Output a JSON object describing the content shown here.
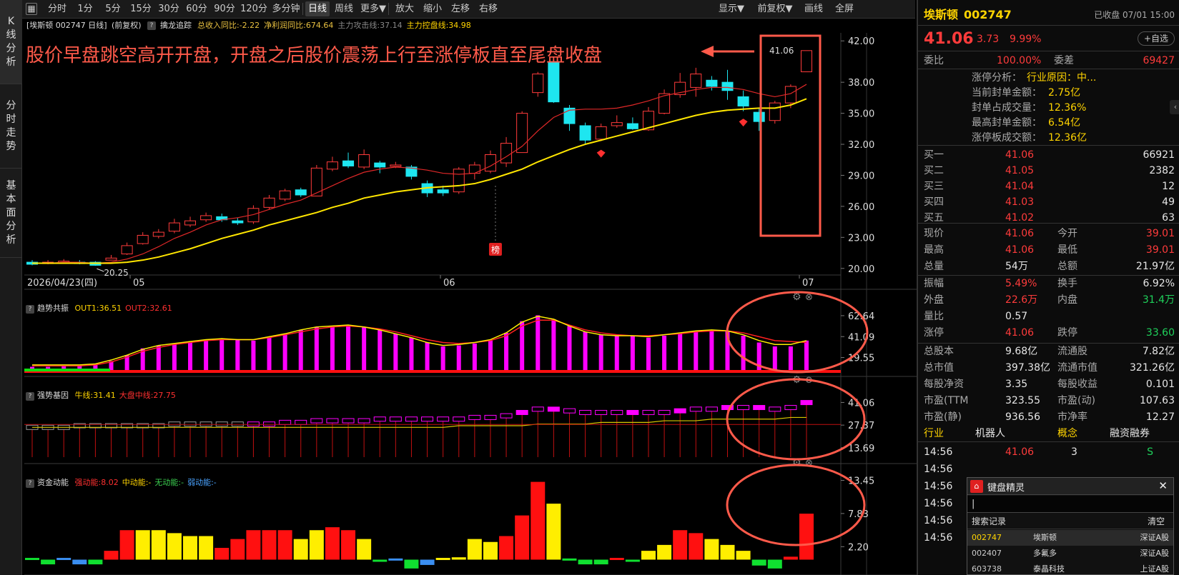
{
  "left_nav": [
    "K线分析",
    "分时走势",
    "基本面分析"
  ],
  "toolbar": {
    "left": [
      "分时",
      "1分",
      "5分",
      "15分",
      "30分",
      "60分",
      "90分",
      "120分",
      "多分钟",
      "日线",
      "周线",
      "更多▼",
      "放大",
      "缩小",
      "左移",
      "右移"
    ],
    "right": [
      "显示▼",
      "前复权▼",
      "画线",
      "全屏"
    ],
    "active": "日线"
  },
  "infobar": {
    "stock": "[埃斯顿 002747 日线]",
    "adj": "(前复权)",
    "indicator_name": "擒龙追踪",
    "fields": [
      {
        "text": "总收入同比:-2.22",
        "color": "#e8c040"
      },
      {
        "text": "净利润同比:674.64",
        "color": "#e8c040"
      },
      {
        "text": "主力攻击线:37.14",
        "color": "#888888"
      },
      {
        "text": "主力控盘线:34.98",
        "color": "#ffd400"
      }
    ]
  },
  "annotation": "股价早盘跳空高开开盘，开盘之后股价震荡上行至涨停板直至尾盘收盘",
  "main_chart": {
    "y_ticks": [
      "42.00",
      "38.00",
      "35.00",
      "32.00",
      "29.00",
      "26.00",
      "23.00",
      "20.00"
    ],
    "x_labels": [
      "2026/04/23(四)",
      "05",
      "06",
      "07"
    ],
    "low_label": "20.25",
    "high_label": "41.06",
    "badge": "榜"
  },
  "chart_data": [
    {
      "type": "candlestick",
      "title": "埃斯顿 002747 日线",
      "ylim": [
        19.5,
        42.5
      ],
      "candles": [
        [
          20.6,
          20.4,
          20.8,
          20.3
        ],
        [
          20.5,
          20.6,
          20.8,
          20.4
        ],
        [
          20.6,
          20.7,
          20.9,
          20.5
        ],
        [
          20.6,
          20.5,
          20.8,
          20.4
        ],
        [
          20.6,
          20.3,
          20.7,
          20.25
        ],
        [
          20.8,
          21.0,
          21.3,
          20.8
        ],
        [
          21.4,
          22.2,
          22.5,
          21.3
        ],
        [
          22.4,
          23.2,
          23.5,
          22.3
        ],
        [
          23.1,
          23.5,
          23.8,
          22.9
        ],
        [
          23.6,
          24.4,
          24.8,
          23.4
        ],
        [
          24.2,
          24.6,
          25.0,
          24.0
        ],
        [
          24.7,
          25.1,
          25.4,
          24.5
        ],
        [
          25.0,
          24.7,
          25.3,
          24.5
        ],
        [
          24.6,
          24.4,
          24.9,
          24.2
        ],
        [
          24.5,
          25.8,
          26.1,
          24.3
        ],
        [
          25.9,
          26.8,
          27.1,
          25.7
        ],
        [
          26.7,
          27.5,
          27.7,
          26.5
        ],
        [
          27.6,
          27.1,
          27.8,
          26.9
        ],
        [
          27.0,
          29.7,
          30.0,
          27.0
        ],
        [
          29.6,
          30.3,
          30.8,
          29.4
        ],
        [
          30.4,
          29.9,
          31.2,
          29.7
        ],
        [
          29.8,
          31.0,
          31.5,
          29.6
        ],
        [
          30.2,
          29.8,
          30.4,
          29.2
        ],
        [
          29.9,
          30.0,
          30.3,
          29.7
        ],
        [
          29.8,
          28.9,
          30.0,
          28.6
        ],
        [
          28.2,
          27.3,
          28.5,
          26.9
        ],
        [
          27.6,
          27.3,
          28.0,
          27.0
        ],
        [
          27.4,
          29.6,
          29.8,
          27.2
        ],
        [
          29.2,
          30.0,
          30.3,
          28.6
        ],
        [
          29.4,
          31.0,
          31.4,
          29.2
        ],
        [
          30.2,
          32.1,
          32.7,
          29.8
        ],
        [
          31.2,
          35.0,
          35.2,
          31.2
        ],
        [
          37.0,
          38.8,
          39.0,
          36.6
        ],
        [
          40.0,
          36.1,
          40.1,
          36.0
        ],
        [
          35.5,
          34.0,
          35.8,
          33.3
        ],
        [
          33.8,
          32.4,
          34.1,
          32.0
        ],
        [
          32.5,
          33.7,
          34.0,
          32.3
        ],
        [
          33.8,
          34.1,
          34.8,
          33.6
        ],
        [
          34.0,
          33.5,
          34.6,
          33.4
        ],
        [
          33.4,
          35.2,
          35.6,
          33.3
        ],
        [
          35.0,
          36.9,
          37.3,
          34.9
        ],
        [
          36.8,
          38.0,
          38.9,
          36.5
        ],
        [
          37.5,
          38.8,
          39.4,
          36.6
        ],
        [
          38.2,
          37.6,
          38.6,
          37.2
        ],
        [
          38.0,
          37.2,
          39.2,
          36.3
        ],
        [
          36.6,
          35.7,
          37.2,
          35.2
        ],
        [
          35.1,
          34.2,
          35.5,
          33.3
        ],
        [
          34.3,
          36.0,
          36.2,
          34.0
        ],
        [
          36.0,
          37.6,
          37.8,
          35.5
        ],
        [
          39.01,
          41.06,
          41.06,
          39.01
        ]
      ],
      "ma_red": [
        20.5,
        20.5,
        20.6,
        20.6,
        20.5,
        20.6,
        20.9,
        21.4,
        22.1,
        22.9,
        23.5,
        24.2,
        24.7,
        24.9,
        25.2,
        25.7,
        26.2,
        26.6,
        27.3,
        28.0,
        28.7,
        29.3,
        29.6,
        29.8,
        29.7,
        29.5,
        29.2,
        29.1,
        29.2,
        29.9,
        30.8,
        31.8,
        33.3,
        34.6,
        35.3,
        35.4,
        35.4,
        35.5,
        35.8,
        36.2,
        36.7,
        37.0,
        37.3,
        37.5,
        37.5,
        37.3,
        36.9,
        36.6,
        36.9,
        37.8
      ],
      "ma_yellow": [
        20.5,
        20.5,
        20.5,
        20.5,
        20.5,
        20.5,
        20.6,
        20.8,
        21.1,
        21.5,
        21.9,
        22.4,
        22.9,
        23.3,
        23.7,
        24.2,
        24.6,
        25.0,
        25.4,
        25.9,
        26.3,
        26.8,
        27.1,
        27.4,
        27.6,
        27.8,
        27.9,
        28.0,
        28.2,
        28.6,
        29.1,
        29.6,
        30.3,
        30.9,
        31.5,
        32.0,
        32.4,
        32.8,
        33.2,
        33.6,
        34.0,
        34.4,
        34.8,
        35.1,
        35.3,
        35.4,
        35.5,
        35.5,
        35.8,
        36.4
      ]
    },
    {
      "type": "bar",
      "title": "趋势共振",
      "legend": [
        {
          "name": "OUT1:36.51",
          "color": "#ffd400"
        },
        {
          "name": "OUT2:32.61",
          "color": "#ff3030"
        }
      ],
      "ylim": [
        6,
        67
      ],
      "y_ticks": [
        "62.64",
        "41.09",
        "19.55"
      ],
      "values": [
        10,
        10,
        11,
        11,
        12,
        16,
        22,
        29,
        32,
        34,
        36,
        38,
        39,
        38,
        37,
        40,
        44,
        48,
        51,
        52,
        53,
        51,
        48,
        44,
        40,
        35,
        31,
        32,
        34,
        37,
        45,
        57,
        63,
        59,
        52,
        46,
        43,
        42,
        42,
        40,
        42,
        45,
        47,
        48,
        47,
        42,
        35,
        31,
        31,
        37
      ],
      "out1": [
        12,
        12,
        12,
        12,
        13,
        17,
        22,
        28,
        32,
        34,
        36,
        38,
        39,
        38,
        38,
        41,
        44,
        48,
        51,
        52,
        53,
        51,
        48,
        44,
        40,
        35,
        32,
        33,
        35,
        38,
        45,
        56,
        62,
        59,
        52,
        46,
        43,
        42,
        42,
        41,
        43,
        45,
        47,
        48,
        47,
        43,
        37,
        33,
        33,
        37
      ],
      "out2": [
        11,
        11,
        11,
        11,
        12,
        15,
        20,
        26,
        30,
        33,
        35,
        37,
        38,
        38,
        38,
        40,
        43,
        46,
        49,
        51,
        52,
        51,
        49,
        46,
        42,
        38,
        35,
        34,
        35,
        37,
        42,
        52,
        58,
        58,
        53,
        48,
        45,
        43,
        42,
        42,
        43,
        44,
        46,
        47,
        47,
        45,
        41,
        37,
        36,
        35
      ]
    },
    {
      "type": "bar",
      "title": "强势基因",
      "legend": [
        {
          "name": "牛线:31.41",
          "color": "#ffd400"
        },
        {
          "name": "大盘中线:27.75",
          "color": "#ff3030"
        }
      ],
      "ylim": [
        8,
        46
      ],
      "y_ticks": [
        "41.06",
        "27.37",
        "13.69"
      ],
      "values": [
        26,
        26,
        26,
        27,
        27,
        27,
        27,
        27,
        27,
        28,
        28,
        28,
        28,
        28,
        28,
        28,
        29,
        29,
        30,
        30,
        30,
        30,
        31,
        31,
        31,
        31,
        31,
        31,
        32,
        32,
        33,
        35,
        37,
        37,
        36,
        35,
        35,
        35,
        35,
        35,
        35,
        36,
        37,
        37,
        38,
        38,
        38,
        37,
        38,
        41
      ],
      "niu": [
        26,
        26,
        26,
        26,
        26,
        26,
        26,
        26,
        26,
        26,
        26,
        26,
        26,
        26,
        26,
        26,
        26,
        26,
        26,
        26,
        26,
        26,
        26,
        26,
        26,
        26,
        26,
        27,
        27,
        27,
        27,
        27,
        28,
        28,
        28,
        28,
        29,
        29,
        29,
        29,
        30,
        30,
        30,
        31,
        31,
        31,
        31,
        31,
        32,
        32
      ]
    },
    {
      "type": "bar",
      "title": "资金动能",
      "legend": [
        {
          "name": "强动能:8.02",
          "color": "#ff3030"
        },
        {
          "name": "中动能:-",
          "color": "#ffd400"
        },
        {
          "name": "无动能:-",
          "color": "#3cd050"
        },
        {
          "name": "弱动能:-",
          "color": "#4aa3ff"
        }
      ],
      "ylim": [
        -2,
        14
      ],
      "y_ticks": [
        "13.45",
        "7.83",
        "2.20"
      ],
      "values": [
        0.3,
        -0.8,
        0.3,
        -0.8,
        -0.8,
        1.5,
        5,
        5,
        5,
        4.5,
        4,
        4,
        2,
        3.5,
        5,
        5,
        5,
        3.5,
        5,
        5.5,
        5,
        3.5,
        -0.3,
        0.2,
        -1.5,
        -0.9,
        0.3,
        0.4,
        3.5,
        3,
        4,
        7.5,
        13.2,
        9.5,
        0.2,
        -0.8,
        -0.8,
        0.3,
        -0.3,
        1.5,
        2.5,
        5,
        4.5,
        3.5,
        2.5,
        1.5,
        -1,
        -1.5,
        0.5,
        7.8
      ],
      "colors": [
        "g",
        "g",
        "b",
        "b",
        "g",
        "r",
        "r",
        "y",
        "y",
        "y",
        "y",
        "y",
        "r",
        "r",
        "r",
        "r",
        "r",
        "y",
        "y",
        "r",
        "r",
        "y",
        "g",
        "b",
        "g",
        "b",
        "y",
        "y",
        "y",
        "y",
        "r",
        "r",
        "r",
        "y",
        "g",
        "g",
        "g",
        "r",
        "g",
        "y",
        "y",
        "r",
        "r",
        "y",
        "y",
        "y",
        "g",
        "g",
        "r",
        "r"
      ]
    }
  ],
  "panel_headers": {
    "p1": "趋势共振",
    "p2": "强势基因",
    "p3": "资金动能"
  },
  "right": {
    "name": "埃斯顿",
    "code": "002747",
    "date": "已收盘 07/01 15:00",
    "price": "41.06",
    "change": "3.73",
    "pct": "9.99%",
    "watch": "+自选",
    "weibi": "委比",
    "weibi_v": "100.00%",
    "weicha": "委差",
    "weicha_v": "69427",
    "ztfx": "涨停分析：",
    "ztfx_v": "行业原因：中...",
    "seal": [
      {
        "k": "当前封单金额：",
        "v": "2.75亿"
      },
      {
        "k": "封单占成交量：",
        "v": "12.36%"
      },
      {
        "k": "最高封单金额：",
        "v": "6.54亿"
      },
      {
        "k": "涨停板成交额：",
        "v": "12.36亿"
      }
    ],
    "bids": [
      {
        "k": "买一",
        "p": "41.06",
        "v": "66921"
      },
      {
        "k": "买二",
        "p": "41.05",
        "v": "2382"
      },
      {
        "k": "买三",
        "p": "41.04",
        "v": "12"
      },
      {
        "k": "买四",
        "p": "41.03",
        "v": "49"
      },
      {
        "k": "买五",
        "p": "41.02",
        "v": "63"
      }
    ],
    "quote": [
      {
        "k1": "现价",
        "v1": "41.06",
        "c1": "red",
        "k2": "今开",
        "v2": "39.01",
        "c2": "red"
      },
      {
        "k1": "最高",
        "v1": "41.06",
        "c1": "red",
        "k2": "最低",
        "v2": "39.01",
        "c2": "red"
      },
      {
        "k1": "总量",
        "v1": "54万",
        "c1": "white",
        "k2": "总额",
        "v2": "21.97亿",
        "c2": "white"
      }
    ],
    "stats": [
      {
        "k1": "振幅",
        "v1": "5.49%",
        "c1": "red",
        "k2": "换手",
        "v2": "6.92%",
        "c2": "white"
      },
      {
        "k1": "外盘",
        "v1": "22.6万",
        "c1": "red",
        "k2": "内盘",
        "v2": "31.4万",
        "c2": "green"
      },
      {
        "k1": "量比",
        "v1": "0.57",
        "c1": "white",
        "k2": "",
        "v2": "",
        "c2": "white"
      },
      {
        "k1": "涨停",
        "v1": "41.06",
        "c1": "red",
        "k2": "跌停",
        "v2": "33.60",
        "c2": "green"
      }
    ],
    "fund": [
      {
        "k1": "总股本",
        "v1": "9.68亿",
        "k2": "流通股",
        "v2": "7.82亿"
      },
      {
        "k1": "总市值",
        "v1": "397.38亿",
        "k2": "流通市值",
        "v2": "321.26亿"
      },
      {
        "k1": "每股净资",
        "v1": "3.35",
        "k2": "每股收益",
        "v2": "0.101"
      },
      {
        "k1": "市盈(TTM",
        "v1": "323.55",
        "k2": "市盈(动)",
        "v2": "107.63"
      },
      {
        "k1": "市盈(静)",
        "v1": "936.56",
        "k2": "市净率",
        "v2": "12.27"
      }
    ],
    "tags": {
      "k1": "行业",
      "v1": "机器人",
      "k2": "概念",
      "v2": "融资融券"
    },
    "ticks": [
      {
        "t": "14:56",
        "p": "41.06",
        "v": "3",
        "d": "S"
      },
      {
        "t": "14:56"
      },
      {
        "t": "14:56"
      },
      {
        "t": "14:56"
      },
      {
        "t": "14:56"
      },
      {
        "t": "14:56"
      }
    ]
  },
  "popup": {
    "title": "键盘精灵",
    "input": "|",
    "history": "搜索记录",
    "clear": "清空",
    "rows": [
      {
        "code": "002747",
        "name": "埃斯顿",
        "market": "深证A股"
      },
      {
        "code": "002407",
        "name": "多氟多",
        "market": "深证A股"
      },
      {
        "code": "603738",
        "name": "泰晶科技",
        "market": "上证A股"
      }
    ]
  }
}
